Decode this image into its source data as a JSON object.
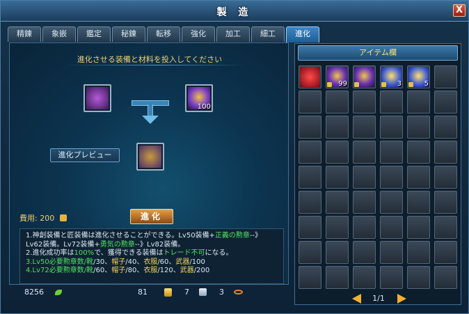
{
  "window": {
    "title": "製 造",
    "close": "X"
  },
  "tabs": [
    {
      "label": "精錬",
      "active": false
    },
    {
      "label": "象嵌",
      "active": false
    },
    {
      "label": "鑑定",
      "active": false
    },
    {
      "label": "秘錬",
      "active": false
    },
    {
      "label": "転移",
      "active": false
    },
    {
      "label": "強化",
      "active": false
    },
    {
      "label": "加工",
      "active": false
    },
    {
      "label": "細工",
      "active": false
    },
    {
      "label": "進化",
      "active": true
    }
  ],
  "evolve": {
    "instruction": "進化させる装備と材料を投入してください",
    "material_qty": "100",
    "preview_label": "進化プレビュー",
    "cost_label": "費用:",
    "cost_value": "200",
    "button_label": "進化"
  },
  "info": {
    "line1a": "1.神創装備と匠装備は進化させることができる。Lv50装備+",
    "line1b": "正義の勲章",
    "line1c": "--》",
    "line2a": "Lv62装備。Lv72装備+",
    "line2b": "勇気の勲章",
    "line2c": "--》Lv82装備。",
    "line3a": "2.進化成功率は",
    "line3b": "100%",
    "line3c": "で、獲得できる装備は",
    "line3d": "トレード不可",
    "line3e": "になる。",
    "line4a": "3.Lv50必要勲章数/靴",
    "line4b": "/30、",
    "line4c": "帽子",
    "line4d": "/40、",
    "line4e": "衣服",
    "line4f": "/60、",
    "line4g": "武器",
    "line4h": "/100",
    "line5a": "4.Lv72必要勲章数/靴",
    "line5b": "/60、",
    "line5c": "帽子",
    "line5d": "/80、",
    "line5e": "衣服",
    "line5f": "/120、",
    "line5g": "武器",
    "line5h": "/200"
  },
  "footer": {
    "leaf": "8256",
    "gold": "81",
    "gem": "7",
    "ring": "3"
  },
  "inventory": {
    "header": "アイテム欄",
    "items": [
      {
        "icon": "red-item-icon",
        "count": ""
      },
      {
        "icon": "medal-icon",
        "count": "99"
      },
      {
        "icon": "medal-icon",
        "count": ""
      },
      {
        "icon": "star-medal-icon",
        "count": "3"
      },
      {
        "icon": "star-medal-icon",
        "count": "5"
      }
    ],
    "page": "1/1"
  }
}
